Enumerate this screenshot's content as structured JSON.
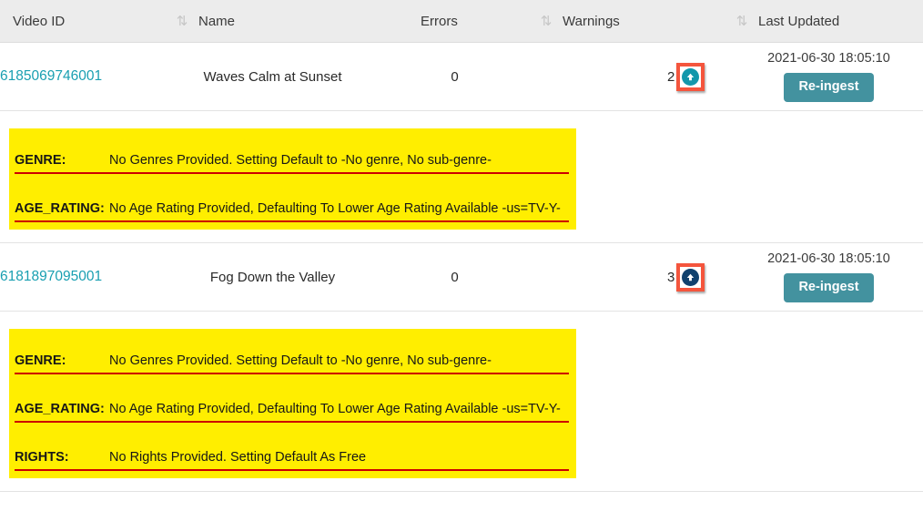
{
  "table": {
    "columns": [
      {
        "key": "video_id",
        "label": "Video ID",
        "sortable": false,
        "sort_icon": "sort-updown-icon"
      },
      {
        "key": "name",
        "label": "Name",
        "sortable": true,
        "sort_icon": "sort-updown-icon"
      },
      {
        "key": "errors",
        "label": "Errors",
        "sortable": false,
        "sort_icon": "sort-updown-icon"
      },
      {
        "key": "warnings",
        "label": "Warnings",
        "sortable": true,
        "sort_icon": "sort-updown-icon"
      },
      {
        "key": "last_updated",
        "label": "Last Updated",
        "sortable": true,
        "sort_icon": "sort-updown-icon"
      }
    ],
    "rows": [
      {
        "video_id": "6185069746001",
        "name": "Waves Calm at Sunset",
        "errors": "0",
        "warnings_count": "2",
        "expand_icon": "arrow-up-circle-icon",
        "expand_icon_color": "#1397ab",
        "expand_highlighted": true,
        "last_updated": "2021-06-30 18:05:10",
        "reingest_label": "Re-ingest",
        "warnings": [
          {
            "key": "GENRE:",
            "message": "No Genres Provided. Setting Default to -No genre, No sub-genre-"
          },
          {
            "key": "AGE_RATING:",
            "message": "No Age Rating Provided, Defaulting To Lower Age Rating Available -us=TV-Y-"
          }
        ]
      },
      {
        "video_id": "6181897095001",
        "name": "Fog Down the Valley",
        "errors": "0",
        "warnings_count": "3",
        "expand_icon": "arrow-up-circle-icon",
        "expand_icon_color": "#10416e",
        "expand_highlighted": true,
        "last_updated": "2021-06-30 18:05:10",
        "reingest_label": "Re-ingest",
        "warnings": [
          {
            "key": "GENRE:",
            "message": "No Genres Provided. Setting Default to -No genre, No sub-genre-"
          },
          {
            "key": "AGE_RATING:",
            "message": "No Age Rating Provided, Defaulting To Lower Age Rating Available -us=TV-Y-"
          },
          {
            "key": "RIGHTS:",
            "message": "No Rights Provided. Setting Default As Free"
          }
        ]
      }
    ]
  },
  "colors": {
    "link": "#199fb1",
    "button": "#43929f",
    "warning_panel": "#ffee00",
    "warning_underline": "#cc0000",
    "highlight_box": "#f4553d",
    "header_bg": "#ececec"
  }
}
